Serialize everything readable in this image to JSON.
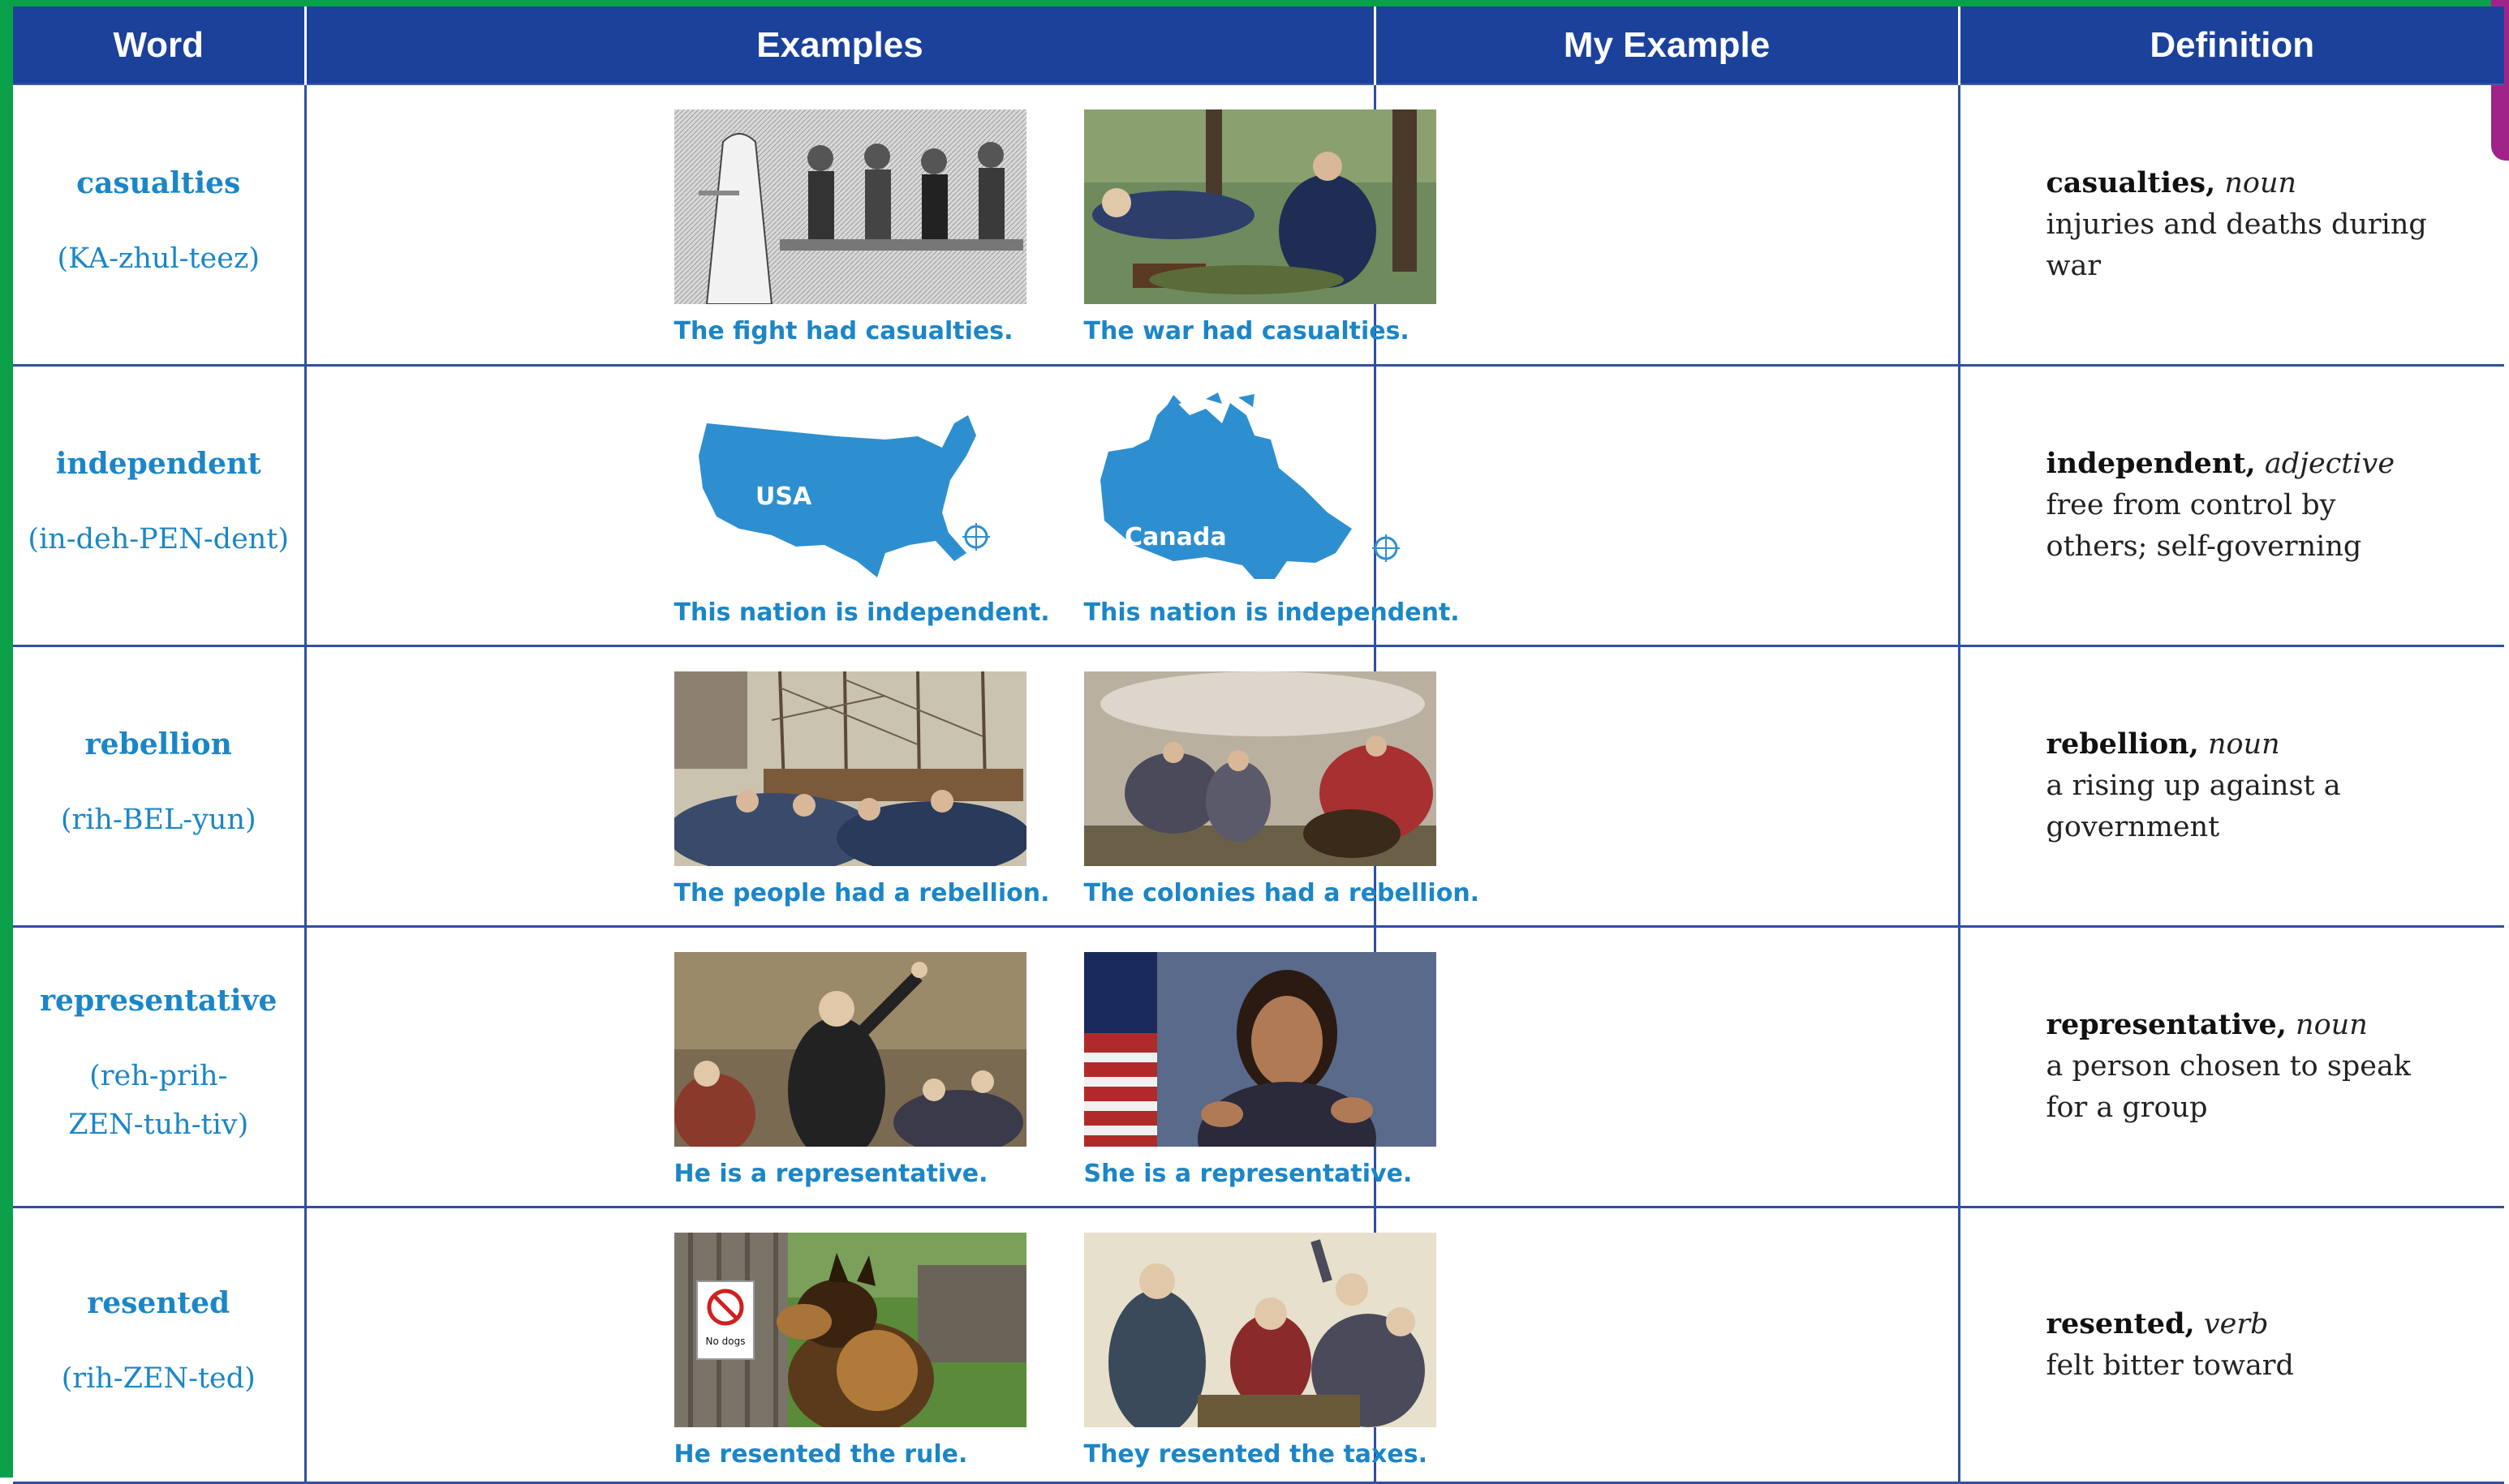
{
  "headers": {
    "word": "Word",
    "examples": "Examples",
    "my_example": "My Example",
    "definition": "Definition"
  },
  "rows": [
    {
      "word": "casualties",
      "pronunciation": "(KA-zhul-teez)",
      "example1": {
        "caption": "The fight had casualties.",
        "image": "colonial-wounded-soldiers-engraving"
      },
      "example2": {
        "caption": "The war had casualties.",
        "image": "wounded-soldiers-painting"
      },
      "definition": {
        "term": "casualties,",
        "pos": "noun",
        "text": "injuries and deaths during war"
      }
    },
    {
      "word": "independent",
      "pronunciation": "(in-deh-PEN-dent)",
      "example1": {
        "caption": "This nation is independent.",
        "image": "usa-map",
        "label": "USA"
      },
      "example2": {
        "caption": "This nation is independent.",
        "image": "canada-map",
        "label": "Canada"
      },
      "definition": {
        "term": "independent,",
        "pos": "adjective",
        "text": "free from control by others; self-governing"
      }
    },
    {
      "word": "rebellion",
      "pronunciation": "(rih-BEL-yun)",
      "example1": {
        "caption": "The people had a rebellion.",
        "image": "crowd-at-ships-harbor"
      },
      "example2": {
        "caption": "The colonies had a rebellion.",
        "image": "battle-scene-painting"
      },
      "definition": {
        "term": "rebellion,",
        "pos": "noun",
        "text": "a rising up against a government"
      }
    },
    {
      "word": "representative",
      "pronunciation": "(reh-prih-ZEN-tuh-tiv)",
      "example1": {
        "caption": "He is a representative.",
        "image": "colonial-speaker-painting"
      },
      "example2": {
        "caption": "She is a representative.",
        "image": "modern-official-speaking-photo"
      },
      "definition": {
        "term": "representative,",
        "pos": "noun",
        "text": "a person chosen to speak for a group"
      }
    },
    {
      "word": "resented",
      "pronunciation": "(rih-ZEN-ted)",
      "example1": {
        "caption": "He resented the rule.",
        "image": "dog-at-no-dogs-sign",
        "sign_text": "No dogs"
      },
      "example2": {
        "caption": "They resented the taxes.",
        "image": "colonial-meeting-painting"
      },
      "definition": {
        "term": "resented,",
        "pos": "verb",
        "text": "felt bitter toward"
      }
    }
  ],
  "colors": {
    "header_bg": "#1b419b",
    "accent_blue": "#1b86c7",
    "frame_green": "#0aa04a",
    "tab_purple": "#a0238a",
    "map_blue": "#2e8fd0"
  }
}
